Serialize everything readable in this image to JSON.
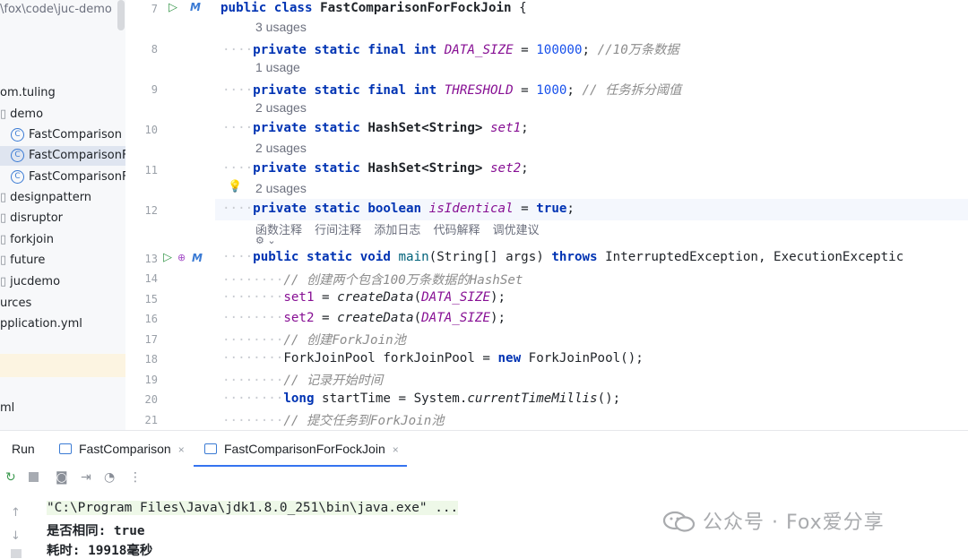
{
  "project": {
    "path": "\\fox\\code\\juc-demo",
    "items": [
      {
        "label": "om.tuling",
        "icon": "",
        "selected": false
      },
      {
        "label": "demo",
        "icon": "folder-icon",
        "selected": false
      },
      {
        "label": "FastComparison",
        "icon": "C",
        "selected": false
      },
      {
        "label": "FastComparisonFo",
        "icon": "C",
        "selected": true
      },
      {
        "label": "FastComparisonFo",
        "icon": "C",
        "selected": false
      },
      {
        "label": "designpattern",
        "icon": "folder-icon",
        "selected": false
      },
      {
        "label": "disruptor",
        "icon": "folder-icon",
        "selected": false
      },
      {
        "label": "forkjoin",
        "icon": "folder-icon",
        "selected": false
      },
      {
        "label": "future",
        "icon": "folder-icon",
        "selected": false
      },
      {
        "label": "jucdemo",
        "icon": "folder-icon",
        "selected": false
      },
      {
        "label": "urces",
        "icon": "",
        "selected": false
      },
      {
        "label": "pplication.yml",
        "icon": "",
        "selected": false
      },
      {
        "label": "ml",
        "icon": "",
        "selected": false
      }
    ]
  },
  "gutter": {
    "lines": [
      "7",
      "8",
      "9",
      "10",
      "11",
      "12",
      "13",
      "14",
      "15",
      "16",
      "17",
      "18",
      "19",
      "20",
      "21"
    ]
  },
  "editor": {
    "hints": [
      "3 usages",
      "1 usage",
      "2 usages",
      "2 usages",
      "2 usages"
    ],
    "ai_actions": [
      "函数注释",
      "行间注释",
      "添加日志",
      "代码解释",
      "调优建议"
    ],
    "ai_sub": "⚙ ⌄",
    "code": {
      "l7": {
        "k1": "public",
        "k2": "class",
        "name": "FastComparisonForFockJoin",
        "rest": " {"
      },
      "l8": {
        "dots": "····",
        "k1": "private",
        "k2": "static",
        "k3": "final",
        "k4": "int",
        "field": "DATA_SIZE",
        "eq": " = ",
        "num": "100000",
        "semi": "; ",
        "cmt": "//10万条数据"
      },
      "l9": {
        "dots": "····",
        "k1": "private",
        "k2": "static",
        "k3": "final",
        "k4": "int",
        "field": "THRESHOLD",
        "eq": " = ",
        "num": "1000",
        "semi": "; ",
        "cmt": "// 任务拆分阈值"
      },
      "l10": {
        "dots": "····",
        "k1": "private",
        "k2": "static",
        "type": "HashSet<String>",
        "field": "set1",
        "semi": ";"
      },
      "l11": {
        "dots": "····",
        "k1": "private",
        "k2": "static",
        "type": "HashSet<String>",
        "field": "set2",
        "semi": ";"
      },
      "l12": {
        "dots": "····",
        "k1": "private",
        "k2": "static",
        "k3": "boolean",
        "field": "isIdentical",
        "eq": " = ",
        "k4": "true",
        "semi": ";"
      },
      "l13": {
        "dots": "····",
        "k1": "public",
        "k2": "static",
        "k3": "void",
        "method": "main",
        "params": "(String[] args) ",
        "k4": "throws",
        "rest": " InterruptedException, ExecutionExceptic"
      },
      "l14": {
        "dots": "········",
        "cmt": "// 创建两个包含100万条数据的HashSet"
      },
      "l15": {
        "dots": "········",
        "field": "set1",
        "eq": " = ",
        "call": "createData",
        "open": "(",
        "arg": "DATA_SIZE",
        "close": ");"
      },
      "l16": {
        "dots": "········",
        "field": "set2",
        "eq": " = ",
        "call": "createData",
        "open": "(",
        "arg": "DATA_SIZE",
        "close": ");"
      },
      "l17": {
        "dots": "········",
        "cmt": "// 创建ForkJoin池"
      },
      "l18": {
        "dots": "········",
        "type": "ForkJoinPool",
        "var": " forkJoinPool",
        "eq": " = ",
        "k1": "new",
        "rest": " ForkJoinPool();"
      },
      "l19": {
        "dots": "········",
        "cmt": "// 记录开始时间"
      },
      "l20": {
        "dots": "········",
        "k1": "long",
        "var": " startTime",
        "eq": " = ",
        "cls": "System",
        "dot": ".",
        "call": "currentTimeMillis",
        "rest": "();"
      },
      "l21": {
        "dots": "········",
        "cmt": "// 提交任务到ForkJoin池"
      }
    }
  },
  "run": {
    "title": "Run",
    "tabs": [
      {
        "label": "FastComparison",
        "close": "×",
        "active": false
      },
      {
        "label": "FastComparisonForFockJoin",
        "close": "×",
        "active": true
      }
    ],
    "console": [
      "\"C:\\Program Files\\Java\\jdk1.8.0_251\\bin\\java.exe\" ...",
      "是否相同: true",
      "耗时: 19918毫秒"
    ]
  },
  "watermark": {
    "text": "公众号 · Fox爱分享"
  },
  "colors": {
    "keyword": "#0033b3",
    "field": "#871094",
    "number": "#1750eb",
    "comment": "#8c8c8c",
    "accent": "#3574f0"
  }
}
